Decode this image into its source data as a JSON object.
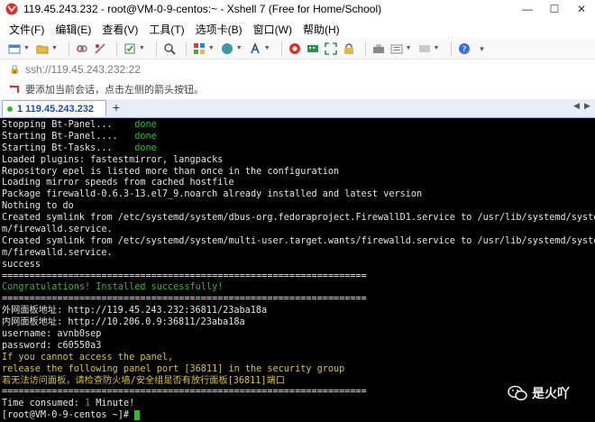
{
  "window": {
    "title": "119.45.243.232 - root@VM-0-9-centos:~ - Xshell 7 (Free for Home/School)",
    "controls": [
      "—",
      "☐",
      "✕"
    ]
  },
  "menu": [
    "文件(F)",
    "编辑(E)",
    "查看(V)",
    "工具(T)",
    "选项卡(B)",
    "窗口(W)",
    "帮助(H)"
  ],
  "toolbar": {
    "icons": [
      "new-session-icon",
      "open-folder-icon",
      "link-icon",
      "disconnect-icon",
      "properties-icon",
      "find-icon",
      "color-scheme-icon",
      "globe-icon",
      "font-icon",
      "xftp-icon",
      "keyboard-icon",
      "fullscreen-icon",
      "lock-icon",
      "compose-icon",
      "options-icon",
      "help-icon"
    ]
  },
  "address": {
    "url": "ssh://119.45.243.232:22"
  },
  "hint": {
    "text": "要添加当前会话，点击左侧的箭头按钮。"
  },
  "tabs": [
    {
      "label": "1 119.45.243.232"
    }
  ],
  "terminal": {
    "lines": [
      {
        "text": "Stopping Bt-Panel...",
        "pad": "    ",
        "status": "done",
        "class": ""
      },
      {
        "text": "Starting Bt-Panel....",
        "pad": "   ",
        "status": "done",
        "class": ""
      },
      {
        "text": "Starting Bt-Tasks...",
        "pad": "    ",
        "status": "done",
        "class": ""
      },
      {
        "text": "Loaded plugins: fastestmirror, langpacks",
        "class": ""
      },
      {
        "text": "Repository epel is listed more than once in the configuration",
        "class": ""
      },
      {
        "text": "Loading mirror speeds from cached hostfile",
        "class": ""
      },
      {
        "text": "Package firewalld-0.6.3-13.el7_9.noarch already installed and latest version",
        "class": ""
      },
      {
        "text": "Nothing to do",
        "class": ""
      },
      {
        "text": "Created symlink from /etc/systemd/system/dbus-org.fedoraproject.FirewallD1.service to /usr/lib/systemd/syste",
        "class": ""
      },
      {
        "text": "m/firewalld.service.",
        "class": ""
      },
      {
        "text": "Created symlink from /etc/systemd/system/multi-user.target.wants/firewalld.service to /usr/lib/systemd/syste",
        "class": ""
      },
      {
        "text": "m/firewalld.service.",
        "class": ""
      },
      {
        "text": "success",
        "class": ""
      },
      {
        "text": "==================================================================",
        "class": ""
      },
      {
        "text": "Congratulations! Installed successfully!",
        "class": "g"
      },
      {
        "text": "==================================================================",
        "class": ""
      },
      {
        "text": "外网面板地址: http://119.45.243.232:36811/23aba18a",
        "class": ""
      },
      {
        "text": "内网面板地址: http://10.206.0.9:36811/23aba18a",
        "class": ""
      },
      {
        "text": "username: avnb0sep",
        "class": ""
      },
      {
        "text": "password: c60550a3",
        "class": ""
      },
      {
        "text": "If you cannot access the panel,",
        "class": "y"
      },
      {
        "text": "release the following panel port [36811] in the security group",
        "class": "y"
      },
      {
        "text": "若无法访问面板，请检查防火墙/安全组是否有放行面板[36811]端口",
        "class": "y"
      },
      {
        "text": "==================================================================",
        "class": ""
      },
      {
        "text": "Time consumed: ",
        "num": "1",
        "suffix": " Minute!",
        "class": ""
      },
      {
        "text": "[root@VM-0-9-centos ~]# ",
        "cursor": true,
        "class": ""
      }
    ]
  },
  "watermark": {
    "text": "是火吖",
    "icon": "wechat-icon"
  },
  "colors": {
    "terminal_bg": "#000000",
    "terminal_fg": "#e6e6e6",
    "green": "#2cbe2c",
    "yellow": "#d9c33a",
    "tab_accent": "#1a4fa0"
  }
}
